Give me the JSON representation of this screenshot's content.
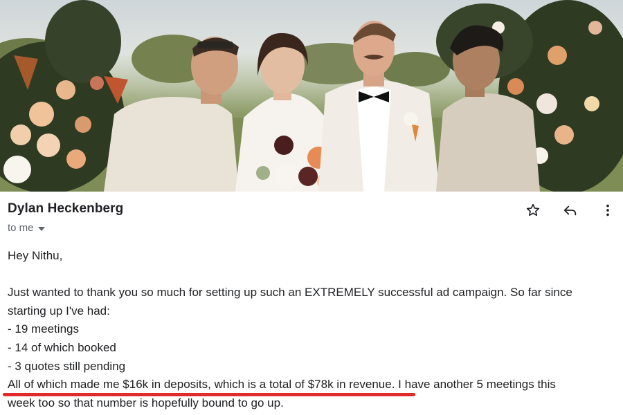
{
  "email": {
    "sender_name": "Dylan Heckenberg",
    "recipient": "to me",
    "greeting": "Hey Nithu,",
    "paragraph_line1": "Just wanted to thank you so much for setting up such an EXTREMELY successful ad campaign. So far since",
    "paragraph_line2": "starting up I've had:",
    "list_items": [
      "- 19 meetings",
      "- 14 of which booked",
      "- 3 quotes still pending"
    ],
    "highlight_text": "All of which made me $16k in deposits, which is a total of $78k in revenue.",
    "continuation_text": " I have another 5 meetings this",
    "last_line": "week too so that number is hopefully bound to go up."
  },
  "icons": {
    "star": "star-icon",
    "reply": "reply-icon",
    "more": "more-vertical-icon",
    "caret": "chevron-down-icon"
  },
  "colors": {
    "underline": "#e02b2b",
    "text": "#202124",
    "secondary": "#5f6368"
  }
}
